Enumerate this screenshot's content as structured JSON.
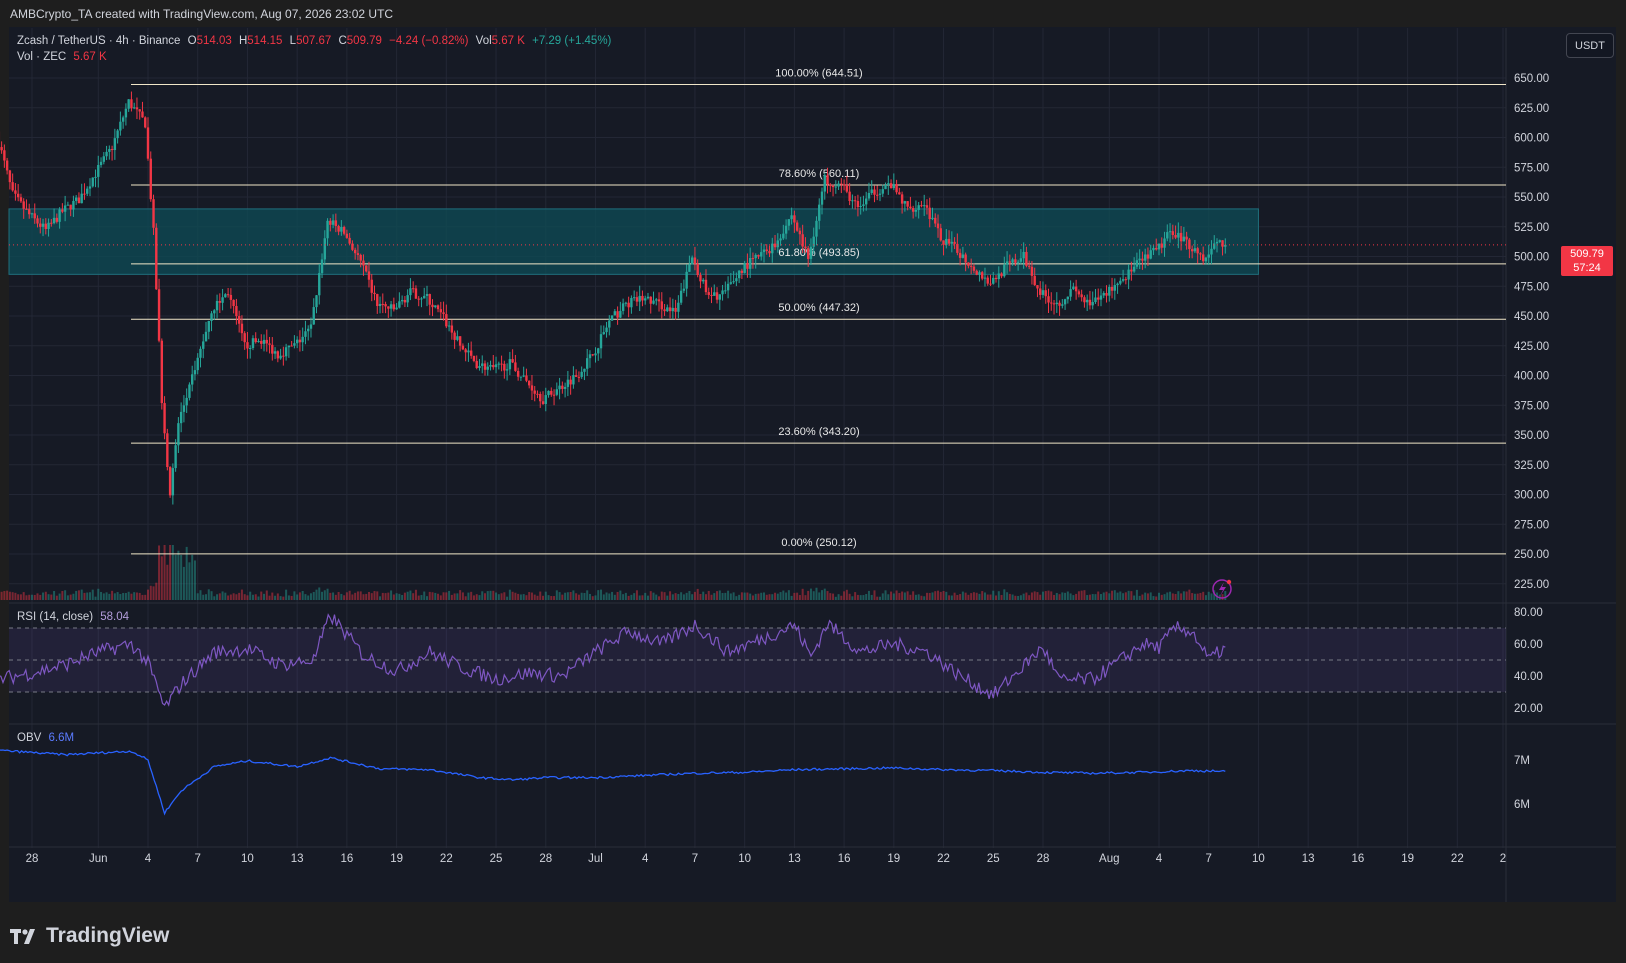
{
  "header": {
    "text": "AMBCrypto_TA created with TradingView.com, Aug 07, 2026 23:02 UTC"
  },
  "legend": {
    "symbol": "Zcash / TetherUS · 4h · Binance",
    "open_label": "O",
    "open": "514.03",
    "high_label": "H",
    "high": "514.15",
    "low_label": "L",
    "low": "507.67",
    "close_label": "C",
    "close": "509.79",
    "change": "−4.24 (−0.82%)",
    "vol_label": "Vol",
    "vol": "5.67 K",
    "vol_change": "+7.29 (+1.45%)",
    "vol_row_label": "Vol · ZEC",
    "vol_row_value": "5.67 K"
  },
  "currency_button": "USDT",
  "price_tag": {
    "price": "509.79",
    "countdown": "57:24"
  },
  "rsi_legend": {
    "label": "RSI (14, close)",
    "value": "58.04"
  },
  "obv_legend": {
    "label": "OBV",
    "value": "6.6M"
  },
  "footer": {
    "brand": "TradingView"
  },
  "colors": {
    "up": "#26a69a",
    "down": "#f23645",
    "zone": "#0e4a55",
    "rsi": "#7e57c2",
    "obv": "#2962ff"
  },
  "chart_data": [
    {
      "type": "candlestick",
      "title": "Zcash / TetherUS · 4h · Binance",
      "ylim": [
        210,
        660
      ],
      "y_ticks": [
        "650.00",
        "625.00",
        "600.00",
        "575.00",
        "550.00",
        "525.00",
        "500.00",
        "475.00",
        "450.00",
        "425.00",
        "400.00",
        "375.00",
        "350.00",
        "325.00",
        "300.00",
        "275.00",
        "250.00",
        "225.00"
      ],
      "x_ticks": [
        "28",
        "Jun",
        "4",
        "7",
        "10",
        "13",
        "16",
        "19",
        "22",
        "25",
        "28",
        "Jul",
        "4",
        "7",
        "10",
        "13",
        "16",
        "19",
        "22",
        "25",
        "28",
        "Aug",
        "4",
        "7",
        "10",
        "13",
        "16",
        "19",
        "22",
        "2"
      ],
      "price_path": [
        [
          "May 26",
          605
        ],
        [
          "May 27",
          552
        ],
        [
          "May 28",
          535
        ],
        [
          "May 29",
          522
        ],
        [
          "May 30",
          538
        ],
        [
          "May 31",
          548
        ],
        [
          "Jun 1",
          570
        ],
        [
          "Jun 2",
          592
        ],
        [
          "Jun 3",
          630
        ],
        [
          "Jun 4",
          612
        ],
        [
          "Jun 4 12:00",
          520
        ],
        [
          "Jun 5",
          380
        ],
        [
          "Jun 5 12:00",
          300
        ],
        [
          "Jun 6",
          360
        ],
        [
          "Jun 7",
          405
        ],
        [
          "Jun 8",
          455
        ],
        [
          "Jun 9",
          470
        ],
        [
          "Jun 10",
          425
        ],
        [
          "Jun 11",
          430
        ],
        [
          "Jun 12",
          418
        ],
        [
          "Jun 13",
          425
        ],
        [
          "Jun 14",
          440
        ],
        [
          "Jun 15",
          530
        ],
        [
          "Jun 16",
          520
        ],
        [
          "Jun 17",
          495
        ],
        [
          "Jun 18",
          460
        ],
        [
          "Jun 19",
          455
        ],
        [
          "Jun 20",
          470
        ],
        [
          "Jun 21",
          465
        ],
        [
          "Jun 22",
          448
        ],
        [
          "Jun 23",
          425
        ],
        [
          "Jun 24",
          410
        ],
        [
          "Jun 25",
          405
        ],
        [
          "Jun 26",
          410
        ],
        [
          "Jun 27",
          395
        ],
        [
          "Jun 28",
          380
        ],
        [
          "Jun 29",
          390
        ],
        [
          "Jun 30",
          400
        ],
        [
          "Jul 1",
          418
        ],
        [
          "Jul 2",
          445
        ],
        [
          "Jul 3",
          460
        ],
        [
          "Jul 4",
          465
        ],
        [
          "Jul 5",
          460
        ],
        [
          "Jul 6",
          452
        ],
        [
          "Jul 7",
          500
        ],
        [
          "Jul 8",
          465
        ],
        [
          "Jul 9",
          470
        ],
        [
          "Jul 10",
          490
        ],
        [
          "Jul 11",
          500
        ],
        [
          "Jul 12",
          510
        ],
        [
          "Jul 13",
          535
        ],
        [
          "Jul 14",
          498
        ],
        [
          "Jul 15",
          565
        ],
        [
          "Jul 16",
          560
        ],
        [
          "Jul 17",
          540
        ],
        [
          "Jul 18",
          555
        ],
        [
          "Jul 19",
          560
        ],
        [
          "Jul 20",
          540
        ],
        [
          "Jul 21",
          545
        ],
        [
          "Jul 22",
          515
        ],
        [
          "Jul 23",
          505
        ],
        [
          "Jul 24",
          490
        ],
        [
          "Jul 25",
          478
        ],
        [
          "Jul 26",
          492
        ],
        [
          "Jul 27",
          500
        ],
        [
          "Jul 28",
          470
        ],
        [
          "Jul 29",
          460
        ],
        [
          "Jul 30",
          472
        ],
        [
          "Jul 31",
          458
        ],
        [
          "Aug 1",
          470
        ],
        [
          "Aug 2",
          482
        ],
        [
          "Aug 3",
          495
        ],
        [
          "Aug 4",
          505
        ],
        [
          "Aug 5",
          522
        ],
        [
          "Aug 6",
          510
        ],
        [
          "Aug 7",
          497
        ],
        [
          "Aug 7 12:00",
          512
        ],
        [
          "Aug 8",
          510
        ]
      ],
      "last_price": 509.79,
      "annotations": {
        "fib_levels": [
          {
            "label": "100.00% (644.51)",
            "price": 644.51
          },
          {
            "label": "78.60% (560.11)",
            "price": 560.11
          },
          {
            "label": "61.80% (493.85)",
            "price": 493.85
          },
          {
            "label": "50.00% (447.32)",
            "price": 447.32
          },
          {
            "label": "23.60% (343.20)",
            "price": 343.2
          },
          {
            "label": "0.00% (250.12)",
            "price": 250.12
          }
        ],
        "zone": {
          "from_price": 485,
          "to_price": 540,
          "from_date": "May 26",
          "to_date": "Aug 10"
        }
      }
    },
    {
      "type": "bar",
      "title": "Vol · ZEC",
      "note": "volume histogram along the bottom of the price pane"
    },
    {
      "type": "line",
      "title": "RSI (14, close)",
      "ylim": [
        12,
        88
      ],
      "y_ticks": [
        "80.00",
        "60.00",
        "40.00",
        "20.00"
      ],
      "band": [
        30,
        70
      ],
      "midline": 50,
      "points": [
        [
          "May 26",
          38
        ],
        [
          "May 28",
          42
        ],
        [
          "May 30",
          47
        ],
        [
          "Jun 1",
          55
        ],
        [
          "Jun 3",
          60
        ],
        [
          "Jun 4",
          48
        ],
        [
          "Jun 5",
          20
        ],
        [
          "Jun 6",
          35
        ],
        [
          "Jun 8",
          55
        ],
        [
          "Jun 10",
          57
        ],
        [
          "Jun 12",
          47
        ],
        [
          "Jun 14",
          50
        ],
        [
          "Jun 15",
          78
        ],
        [
          "Jun 17",
          53
        ],
        [
          "Jun 19",
          43
        ],
        [
          "Jun 21",
          55
        ],
        [
          "Jun 23",
          45
        ],
        [
          "Jun 25",
          38
        ],
        [
          "Jun 27",
          42
        ],
        [
          "Jun 29",
          40
        ],
        [
          "Jul 1",
          55
        ],
        [
          "Jul 3",
          68
        ],
        [
          "Jul 5",
          60
        ],
        [
          "Jul 7",
          72
        ],
        [
          "Jul 9",
          55
        ],
        [
          "Jul 11",
          63
        ],
        [
          "Jul 13",
          72
        ],
        [
          "Jul 14",
          52
        ],
        [
          "Jul 15",
          73
        ],
        [
          "Jul 17",
          55
        ],
        [
          "Jul 19",
          60
        ],
        [
          "Jul 21",
          55
        ],
        [
          "Jul 23",
          40
        ],
        [
          "Jul 25",
          28
        ],
        [
          "Jul 27",
          48
        ],
        [
          "Jul 28",
          58
        ],
        [
          "Jul 29",
          37
        ],
        [
          "Jul 31",
          38
        ],
        [
          "Aug 2",
          52
        ],
        [
          "Aug 3",
          60
        ],
        [
          "Aug 4",
          58
        ],
        [
          "Aug 5",
          70
        ],
        [
          "Aug 6",
          68
        ],
        [
          "Aug 7",
          50
        ],
        [
          "Aug 8",
          58
        ]
      ]
    },
    {
      "type": "line",
      "title": "OBV",
      "ylim": [
        5.6,
        7.4
      ],
      "y_ticks": [
        "7M",
        "6M"
      ],
      "points": [
        [
          "May 26",
          7.22
        ],
        [
          "May 30",
          7.12
        ],
        [
          "Jun 3",
          7.2
        ],
        [
          "Jun 4",
          7.0
        ],
        [
          "Jun 5",
          5.8
        ],
        [
          "Jun 6",
          6.3
        ],
        [
          "Jun 8",
          6.85
        ],
        [
          "Jun 10",
          6.98
        ],
        [
          "Jun 13",
          6.85
        ],
        [
          "Jun 15",
          7.05
        ],
        [
          "Jun 18",
          6.8
        ],
        [
          "Jun 21",
          6.78
        ],
        [
          "Jun 24",
          6.6
        ],
        [
          "Jun 26",
          6.55
        ],
        [
          "Jun 28",
          6.6
        ],
        [
          "Jul 1",
          6.6
        ],
        [
          "Jul 4",
          6.65
        ],
        [
          "Jul 7",
          6.7
        ],
        [
          "Jul 10",
          6.72
        ],
        [
          "Jul 13",
          6.78
        ],
        [
          "Jul 16",
          6.8
        ],
        [
          "Jul 19",
          6.82
        ],
        [
          "Jul 22",
          6.78
        ],
        [
          "Jul 25",
          6.76
        ],
        [
          "Jul 28",
          6.72
        ],
        [
          "Jul 31",
          6.7
        ],
        [
          "Aug 3",
          6.72
        ],
        [
          "Aug 6",
          6.76
        ],
        [
          "Aug 8",
          6.74
        ]
      ]
    }
  ]
}
